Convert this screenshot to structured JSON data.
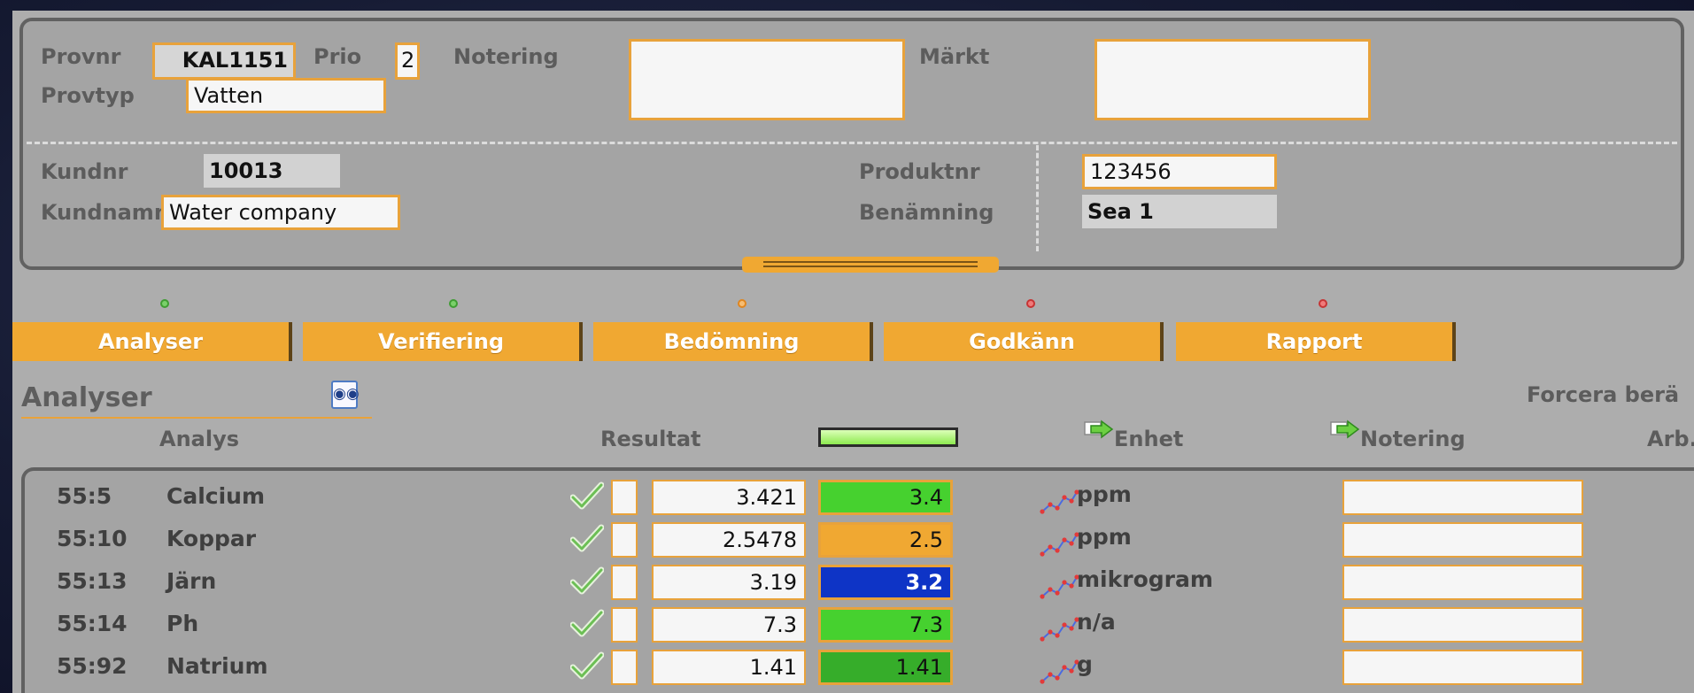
{
  "header": {
    "provnr": {
      "label": "Provnr",
      "value": "KAL1151"
    },
    "prio": {
      "label": "Prio",
      "value": "2"
    },
    "notering": {
      "label": "Notering",
      "value": ""
    },
    "markt": {
      "label": "Märkt",
      "value": ""
    },
    "provtyp": {
      "label": "Provtyp",
      "value": "Vatten"
    },
    "kundnr": {
      "label": "Kundnr",
      "value": "10013"
    },
    "kundnamn": {
      "label": "Kundnamn",
      "value": "Water company"
    },
    "produktnr": {
      "label": "Produktnr",
      "value": "123456"
    },
    "benamning": {
      "label": "Benämning",
      "value": "Sea 1"
    }
  },
  "workflow": {
    "tabs": [
      {
        "label": "Analyser",
        "status": "green"
      },
      {
        "label": "Verifiering",
        "status": "green"
      },
      {
        "label": "Bedömning",
        "status": "orange"
      },
      {
        "label": "Godkänn",
        "status": "red"
      },
      {
        "label": "Rapport",
        "status": "red"
      }
    ]
  },
  "analyser": {
    "title": "Analyser",
    "force_label": "Forcera berä",
    "columns": {
      "analys": "Analys",
      "resultat": "Resultat",
      "enhet": "Enhet",
      "notering": "Notering",
      "arb": "Arb."
    },
    "rows": [
      {
        "id": "55:5",
        "name": "Calcium",
        "raw": "3.421",
        "rounded": "3.4",
        "color": "#46d12f",
        "text_color": "#111111",
        "unit": "ppm"
      },
      {
        "id": "55:10",
        "name": "Koppar",
        "raw": "2.5478",
        "rounded": "2.5",
        "color": "#f0a832",
        "text_color": "#111111",
        "unit": "ppm"
      },
      {
        "id": "55:13",
        "name": "Järn",
        "raw": "3.19",
        "rounded": "3.2",
        "color": "#0e34c6",
        "text_color": "#ffffff",
        "unit": "mikrogram"
      },
      {
        "id": "55:14",
        "name": "Ph",
        "raw": "7.3",
        "rounded": "7.3",
        "color": "#46d12f",
        "text_color": "#111111",
        "unit": "n/a"
      },
      {
        "id": "55:92",
        "name": "Natrium",
        "raw": "1.41",
        "rounded": "1.41",
        "color": "#36ad2a",
        "text_color": "#111111",
        "unit": "g"
      }
    ]
  }
}
